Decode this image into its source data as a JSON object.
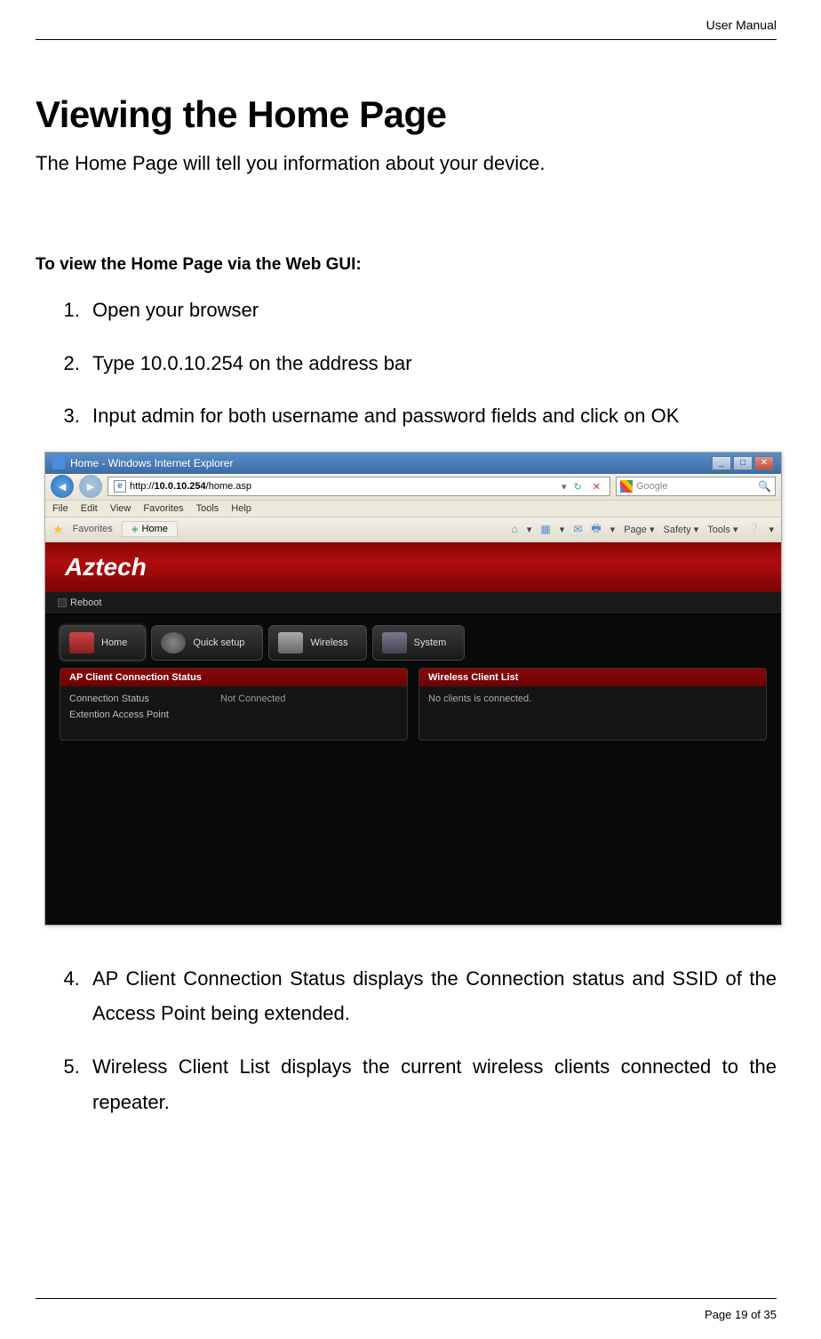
{
  "header": {
    "label": "User Manual"
  },
  "title": "Viewing the Home Page",
  "intro": "The Home Page will tell you information about your device.",
  "sub_heading": "To view the Home Page via the Web GUI:",
  "steps": {
    "s1": "Open your browser",
    "s2": "Type 10.0.10.254 on the address bar",
    "s3": "Input admin for both username and password fields and click on OK",
    "s4": "AP Client Connection Status displays the Connection status and SSID of the Access Point being extended.",
    "s5": "Wireless Client List displays the current wireless clients connected to the repeater."
  },
  "browser": {
    "window_title": "Home - Windows Internet Explorer",
    "url_prefix": "http://",
    "url_host": "10.0.10.254",
    "url_path": "/home.asp",
    "search_placeholder": "Google",
    "menu": {
      "file": "File",
      "edit": "Edit",
      "view": "View",
      "favorites": "Favorites",
      "tools": "Tools",
      "help": "Help"
    },
    "favorites_label": "Favorites",
    "tab_label": "Home",
    "toolbar": {
      "page": "Page",
      "safety": "Safety",
      "tools": "Tools"
    }
  },
  "app": {
    "logo": "Aztech",
    "reboot": "Reboot",
    "tabs": {
      "home": "Home",
      "quick": "Quick setup",
      "wireless": "Wireless",
      "system": "System"
    },
    "panel_left": {
      "title": "AP Client Connection Status",
      "row1_label": "Connection Status",
      "row1_value": "Not Connected",
      "row2_label": "Extention Access Point",
      "row2_value": ""
    },
    "panel_right": {
      "title": "Wireless Client List",
      "body": "No clients is connected."
    }
  },
  "footer": {
    "text": "Page 19 of 35"
  }
}
